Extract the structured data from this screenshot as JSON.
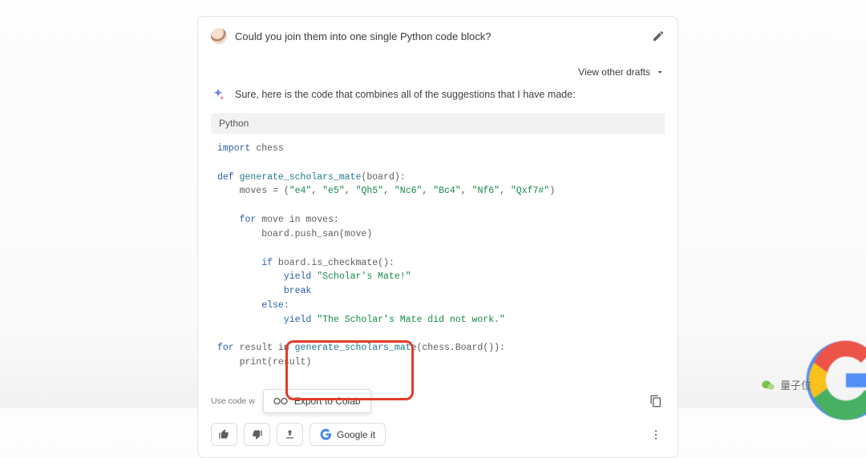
{
  "header": {
    "user_question": "Could you join them into one single Python code block?"
  },
  "drafts_toggle": "View other drafts",
  "intro_text": "Sure, here is the code that combines all of the suggestions that I have made:",
  "code_lang": "Python",
  "code": {
    "l1_kw": "import",
    "l1_id": " chess",
    "l2_kw": "def ",
    "l2_fn": "generate_scholars_mate",
    "l2_rest": "(board):",
    "l3": "    moves = (",
    "l3_s1": "\"e4\"",
    "l3_c1": ", ",
    "l3_s2": "\"e5\"",
    "l3_c2": ", ",
    "l3_s3": "\"Qh5\"",
    "l3_c3": ", ",
    "l3_s4": "\"Nc6\"",
    "l3_c4": ", ",
    "l3_s5": "\"Bc4\"",
    "l3_c5": ", ",
    "l3_s6": "\"Nf6\"",
    "l3_c6": ", ",
    "l3_s7": "\"Qxf7#\"",
    "l3_end": ")",
    "l4_kw": "    for",
    "l4_rest": " move in moves:",
    "l5": "        board.push_san(move)",
    "l6_kw": "        if",
    "l6_rest": " board.is_checkmate():",
    "l7_kw": "            yield ",
    "l7_str": "\"Scholar's Mate!\"",
    "l8_kw": "            break",
    "l9_kw": "        else",
    "l9_rest": ":",
    "l10_kw": "            yield ",
    "l10_str": "\"The Scholar's Mate did not work.\"",
    "l11_kw": "for",
    "l11_rest": " result in ",
    "l11_fn": "generate_scholars_mate",
    "l11_tail": "(chess.Board()):",
    "l12": "    print(result)"
  },
  "caution_label": "Use code w",
  "export_label": "Export to Colab",
  "google_it_label": "Google it",
  "watermark_text": "量子位"
}
